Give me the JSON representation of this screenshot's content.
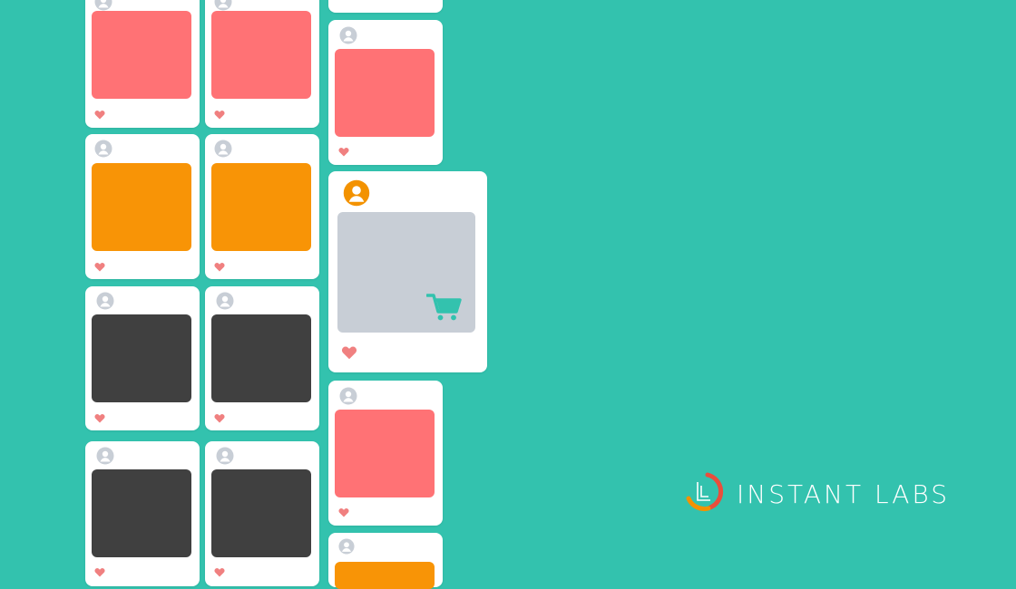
{
  "brand": {
    "name": "INSTANT LABS",
    "colors": {
      "background": "#33c2ae",
      "card": "#ffffff",
      "like": "#f08080",
      "accent_orange": "#f39200",
      "ring_red": "#e94e3c"
    }
  },
  "feed": {
    "post_colors": {
      "coral": "#ff7275",
      "orange": "#f89406",
      "dark": "#404040",
      "placeholder": "#c8ced6"
    },
    "featured": {
      "avatar_color": "#f39200",
      "icon": "shopping-cart-icon",
      "media_color": "#c8ced6"
    }
  },
  "icons": {
    "avatar": "user-avatar-icon",
    "like": "heart-icon",
    "cart": "shopping-cart-icon",
    "logo": "instant-labs-logo-icon"
  }
}
